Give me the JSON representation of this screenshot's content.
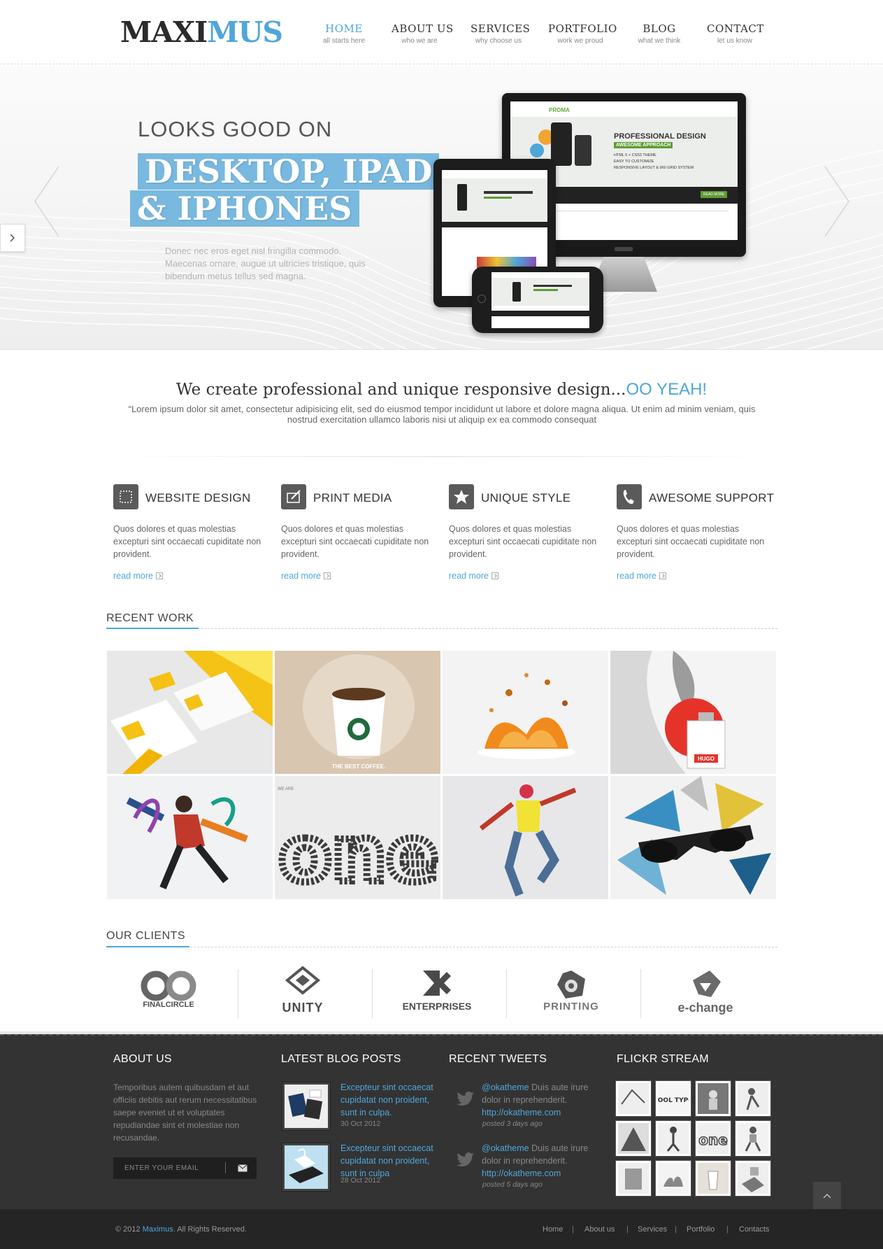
{
  "logo": {
    "part1": "MAXI",
    "part2": "MUS"
  },
  "nav": [
    {
      "label": "HOME",
      "sub": "all starts here",
      "active": true
    },
    {
      "label": "ABOUT US",
      "sub": "who we are"
    },
    {
      "label": "SERVICES",
      "sub": "why choose us"
    },
    {
      "label": "PORTFOLIO",
      "sub": "work we proud"
    },
    {
      "label": "BLOG",
      "sub": "what we think"
    },
    {
      "label": "CONTACT",
      "sub": "let us know"
    }
  ],
  "hero": {
    "eyebrow": "LOOKS GOOD ON",
    "headline_line1": "DESKTOP, IPAD",
    "headline_line2": "& IPHONES",
    "description": "Donec nec eros eget nisl fringilla commodo. Maecenas ornare, augue ut ultricies tristique, quis bibendum metus tellus sed magna.",
    "device_screen": {
      "brand": "PROMA",
      "heading": "PROFESSIONAL DESIGN",
      "subheading": "AWESOME APPROACH",
      "bullets": [
        "HTML 5 + CSS3 THEME",
        "EASY TO CUSTOMIZE",
        "RESPONSIVE LAYOUT & 960 GRID SYSTEM"
      ],
      "button": "READ MORE"
    }
  },
  "intro": {
    "title": "We create professional and unique responsive design...",
    "title_accent": "OO YEAH!",
    "quote": "“Lorem ipsum dolor sit amet, consectetur adipisicing elit, sed do eiusmod tempor incididunt ut labore et dolore magna aliqua. Ut enim ad minim veniam, quis nostrud exercitation ullamco laboris nisi ut aliquip ex ea commodo consequat"
  },
  "services": [
    {
      "icon": "frame-dashed-icon",
      "title": "WEBSITE DESIGN",
      "text": "Quos dolores et quas molestias excepturi sint occaecati cupiditate non provident.",
      "link": "read more"
    },
    {
      "icon": "edit-box-icon",
      "title": "PRINT MEDIA",
      "text": "Quos dolores et quas molestias excepturi sint occaecati cupiditate non provident.",
      "link": "read more"
    },
    {
      "icon": "star-icon",
      "title": "UNIQUE STYLE",
      "text": "Quos dolores et quas molestias excepturi sint occaecati cupiditate non provident.",
      "link": "read more"
    },
    {
      "icon": "phone-icon",
      "title": "AWESOME SUPPORT",
      "text": "Quos dolores et quas molestias excepturi sint occaecati cupiditate non provident.",
      "link": "read more"
    }
  ],
  "recent_work": {
    "heading": "RECENT WORK",
    "coffee_caption": "THE BEST COFFEE.",
    "perfume_label": "HUGO",
    "one_small_label": "WE ARE",
    "one_word": "one"
  },
  "clients": {
    "heading": "OUR CLIENTS",
    "items": [
      "FINALCIRCLE",
      "UNITY",
      "ENTERPRISES",
      "PRINTING",
      "e-change"
    ]
  },
  "footer": {
    "about": {
      "heading": "ABOUT US",
      "text": "Temporibus autem quibusdam et aut officiis debitis aut rerum necessitatibus saepe eveniet ut et voluptates repudiandae sint et molestiae non recusandae.",
      "email_placeholder": "ENTER YOUR EMAIL"
    },
    "blog": {
      "heading": "LATEST BLOG POSTS",
      "posts": [
        {
          "title": "Excepteur sint occaecat cupidatat non proident, sunt in culpa.",
          "date": "30 Oct 2012"
        },
        {
          "title": "Excepteur sint occaecat cupidatat non proident, sunt in culpa",
          "date": "28 Oct 2012"
        }
      ]
    },
    "tweets": {
      "heading": "RECENT TWEETS",
      "items": [
        {
          "handle": "@okatheme",
          "text": " Duis aute irure dolor in reprehenderit.",
          "link": "http://okatheme.com",
          "time": "posted 3 days ago"
        },
        {
          "handle": "@okatheme",
          "text": " Duis aute irure dolor in reprehenderit.",
          "link": "http://okatheme.com",
          "time": "posted 5 days ago"
        }
      ]
    },
    "flickr": {
      "heading": "FLICKR STREAM",
      "word_one": "one",
      "word_cool": "COOL TYPO"
    }
  },
  "bottom": {
    "copyright_prefix": "©  2012 ",
    "brand": "Maximus",
    "copyright_suffix": ". All Rights Reserved.",
    "links": [
      "Home",
      "About us",
      "Services",
      "Portfolio",
      "Contacts"
    ]
  },
  "colors": {
    "accent": "#4fa7d8",
    "dark": "#333333",
    "footer_bottom": "#252525"
  }
}
